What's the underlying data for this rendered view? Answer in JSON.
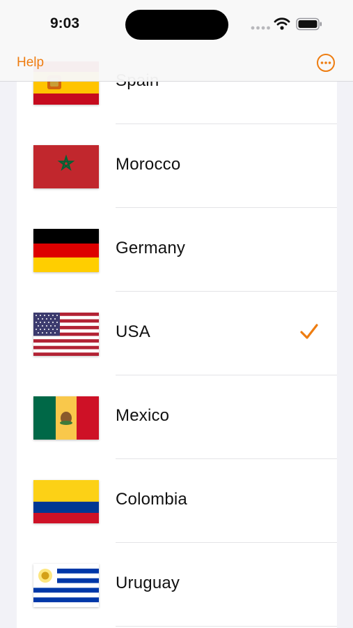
{
  "status_bar": {
    "time": "9:03"
  },
  "nav": {
    "left_button": "Help",
    "right_icon": "ellipsis-circle-icon"
  },
  "colors": {
    "accent": "#ee7d11",
    "background": "#f2f2f7",
    "card": "#ffffff",
    "divider": "#e3e3e6"
  },
  "countries": [
    {
      "name": "Spain",
      "flag_icon": "spain-flag-icon",
      "selected": false
    },
    {
      "name": "Morocco",
      "flag_icon": "morocco-flag-icon",
      "selected": false
    },
    {
      "name": "Germany",
      "flag_icon": "germany-flag-icon",
      "selected": false
    },
    {
      "name": "USA",
      "flag_icon": "usa-flag-icon",
      "selected": true
    },
    {
      "name": "Mexico",
      "flag_icon": "mexico-flag-icon",
      "selected": false
    },
    {
      "name": "Colombia",
      "flag_icon": "colombia-flag-icon",
      "selected": false
    },
    {
      "name": "Uruguay",
      "flag_icon": "uruguay-flag-icon",
      "selected": false
    }
  ]
}
